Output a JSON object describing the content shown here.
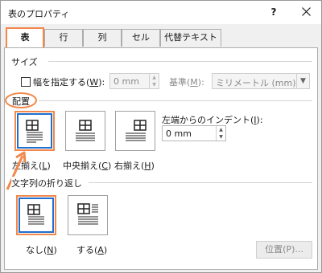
{
  "window": {
    "title": "表のプロパティ",
    "help": "?"
  },
  "tabs": [
    "表",
    "行",
    "列",
    "セル",
    "代替テキスト"
  ],
  "size": {
    "group_label": "サイズ",
    "width_checkbox_label": "幅を指定する(",
    "width_key": "W",
    "width_value": "0 mm",
    "basis_label": "基準(",
    "basis_key": "M",
    "basis_value": "ミリメートル (mm)"
  },
  "align": {
    "group_label": "配置",
    "options": [
      {
        "text": "左揃え(",
        "key": "L"
      },
      {
        "text": "中央揃え(",
        "key": "C"
      },
      {
        "text": "右揃え(",
        "key": "H"
      }
    ],
    "indent_label": "左端からのインデント(",
    "indent_key": "I",
    "indent_value": "0 mm"
  },
  "wrap": {
    "group_label": "文字列の折り返し",
    "options": [
      {
        "text": "なし(",
        "key": "N"
      },
      {
        "text": "する(",
        "key": "A"
      }
    ],
    "position_button": "位置(P)..."
  },
  "colors": {
    "highlight": "#f2884b",
    "selected_blue": "#1e6fd0"
  }
}
